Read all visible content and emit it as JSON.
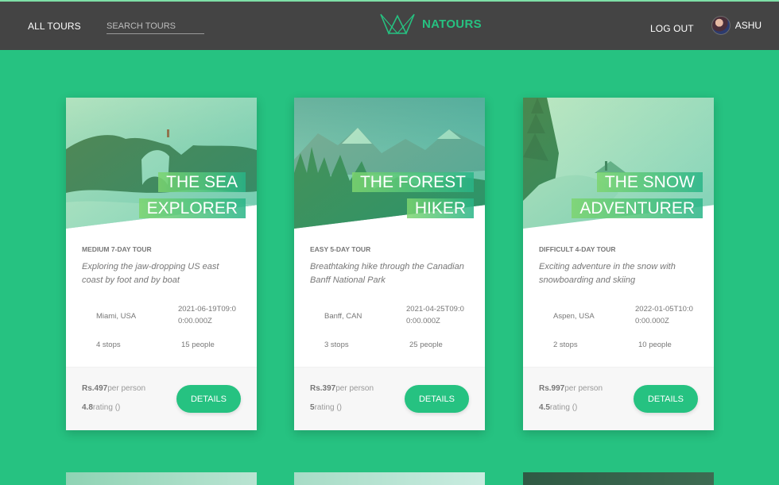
{
  "nav": {
    "all_tours": "All tours",
    "search_placeholder": "Search tours",
    "logo_text": "natours",
    "logout": "Log out",
    "user_name": "Ashu"
  },
  "tours": [
    {
      "title_lines": [
        "THE SEA",
        "EXPLORER"
      ],
      "subheading": "medium 7-day tour",
      "summary": "Exploring the jaw-dropping US east coast by foot and by boat",
      "location": "Miami, USA",
      "date": "2021-06-19T09:00:00.000Z",
      "stops": "4 stops",
      "people": "15 people",
      "price": "Rs.497",
      "price_suffix": "per person",
      "rating": "4.8",
      "rating_suffix": "rating ()",
      "button": "Details",
      "image_colors": [
        "#5b7d6a",
        "#9fd3cf",
        "#2e4a35"
      ]
    },
    {
      "title_lines": [
        "THE FOREST",
        "HIKER"
      ],
      "subheading": "easy 5-day tour",
      "summary": "Breathtaking hike through the Canadian Banff National Park",
      "location": "Banff, CAN",
      "date": "2021-04-25T09:00:00.000Z",
      "stops": "3 stops",
      "people": "25 people",
      "price": "Rs.397",
      "price_suffix": "per person",
      "rating": "5",
      "rating_suffix": "rating ()",
      "button": "Details",
      "image_colors": [
        "#7fb6c9",
        "#9fcfd8",
        "#2f6d48"
      ]
    },
    {
      "title_lines": [
        "THE SNOW",
        "ADVENTURER"
      ],
      "subheading": "difficult 4-day tour",
      "summary": "Exciting adventure in the snow with snowboarding and skiing",
      "location": "Aspen, USA",
      "date": "2022-01-05T10:00:00.000Z",
      "stops": "2 stops",
      "people": "10 people",
      "price": "Rs.997",
      "price_suffix": "per person",
      "rating": "4.5",
      "rating_suffix": "rating ()",
      "button": "Details",
      "image_colors": [
        "#cfe9e2",
        "#e9f4f1",
        "#2f5f3e"
      ]
    }
  ],
  "colors": {
    "accent": "#26c281",
    "header_bg": "#444444",
    "page_bg": "#26c281"
  }
}
